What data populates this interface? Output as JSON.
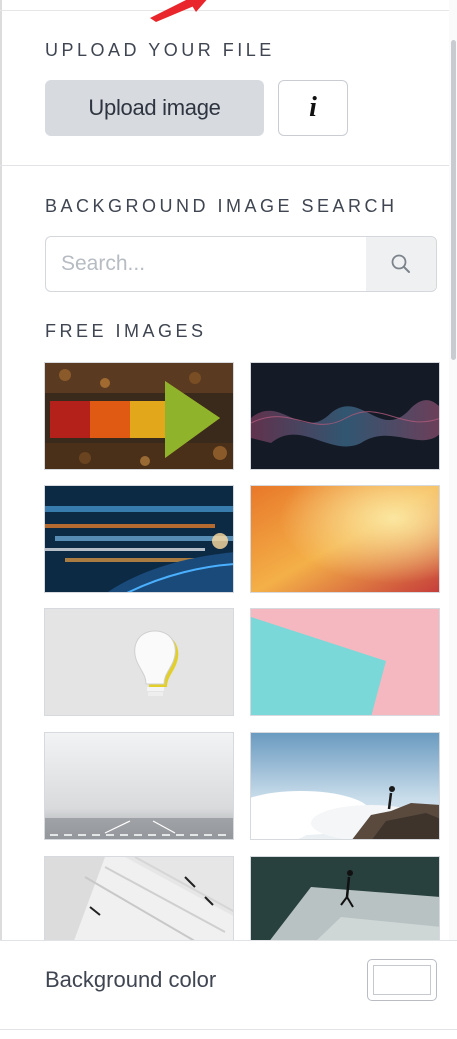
{
  "upload": {
    "section_title": "UPLOAD YOUR FILE",
    "button_label": "Upload image",
    "info_label": "i"
  },
  "search": {
    "section_title": "BACKGROUND IMAGE SEARCH",
    "placeholder": "Search..."
  },
  "free_images": {
    "section_title": "FREE IMAGES",
    "items": [
      {
        "name": "autumn-leaves-arrow"
      },
      {
        "name": "dark-sound-wave"
      },
      {
        "name": "light-speed-trails"
      },
      {
        "name": "orange-gradient-blur"
      },
      {
        "name": "paper-lightbulb"
      },
      {
        "name": "teal-pink-paper"
      },
      {
        "name": "foggy-road"
      },
      {
        "name": "runner-above-clouds"
      },
      {
        "name": "white-architecture"
      },
      {
        "name": "runner-on-concrete"
      }
    ]
  },
  "background_color": {
    "label": "Background color",
    "value": "#ffffff"
  },
  "colors": {
    "accent_arrow": "#e8262b",
    "button_gray": "#d7dbe0"
  }
}
